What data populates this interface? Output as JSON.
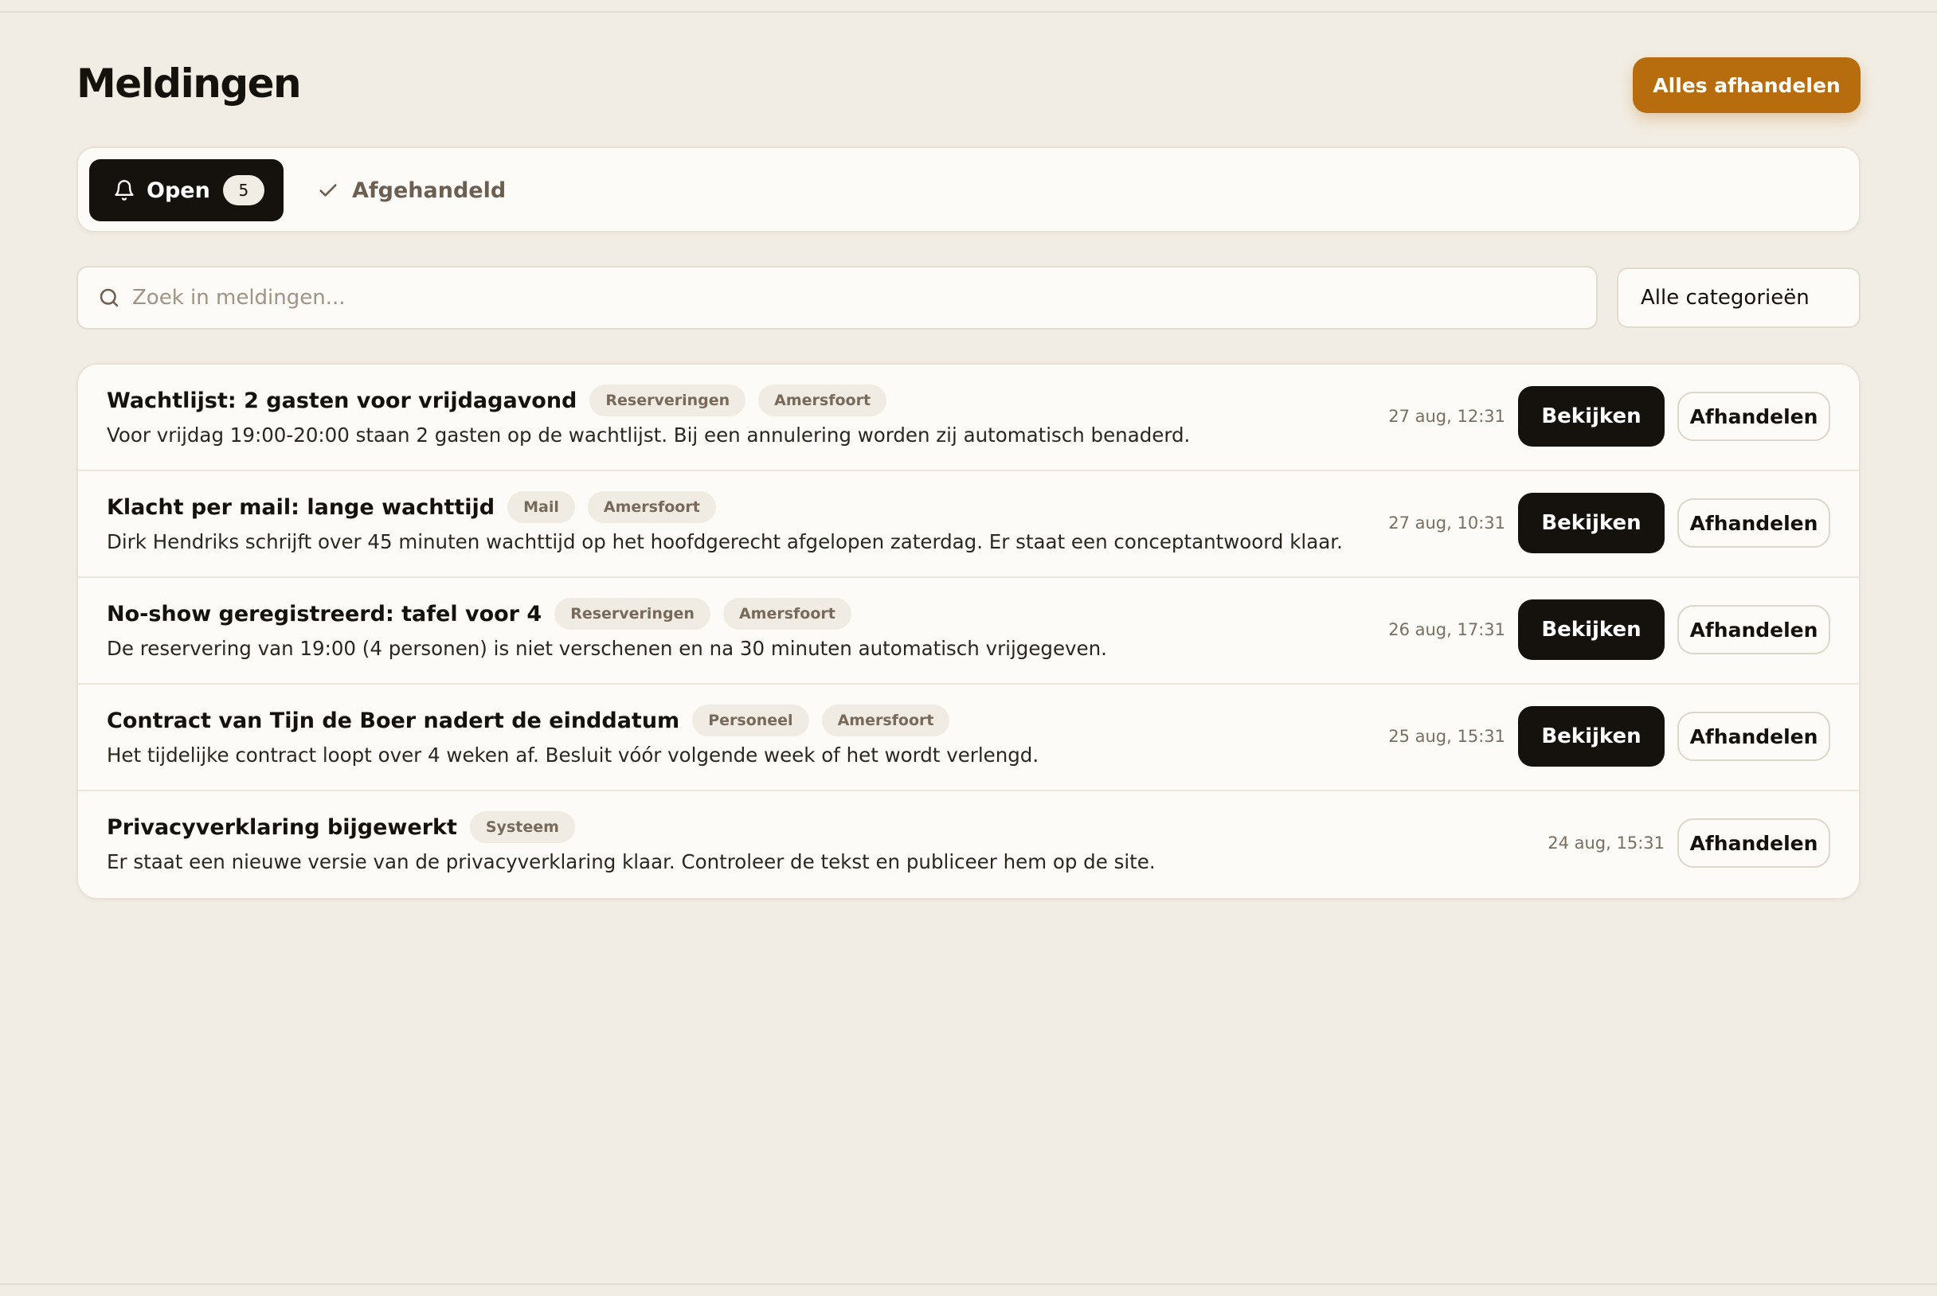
{
  "header": {
    "title": "Meldingen",
    "primary_action": "Alles afhandelen"
  },
  "tabs": {
    "open": {
      "label": "Open",
      "count": "5"
    },
    "done": {
      "label": "Afgehandeld"
    }
  },
  "search": {
    "placeholder": "Zoek in meldingen..."
  },
  "filter": {
    "selected": "Alle categorieën"
  },
  "actions": {
    "view": "Bekijken",
    "handle": "Afhandelen"
  },
  "notifications": [
    {
      "title": "Wachtlijst: 2 gasten voor vrijdagavond",
      "tags": [
        "Reserveringen",
        "Amersfoort"
      ],
      "description": "Voor vrijdag 19:00-20:00 staan 2 gasten op de wachtlijst. Bij een annulering worden zij automatisch benaderd.",
      "time": "27 aug, 12:31"
    },
    {
      "title": "Klacht per mail: lange wachttijd",
      "tags": [
        "Mail",
        "Amersfoort"
      ],
      "description": "Dirk Hendriks schrijft over 45 minuten wachttijd op het hoofdgerecht afgelopen zaterdag. Er staat een conceptantwoord klaar.",
      "time": "27 aug, 10:31"
    },
    {
      "title": "No-show geregistreerd: tafel voor 4",
      "tags": [
        "Reserveringen",
        "Amersfoort"
      ],
      "description": "De reservering van 19:00 (4 personen) is niet verschenen en na 30 minuten automatisch vrijgegeven.",
      "time": "26 aug, 17:31"
    },
    {
      "title": "Contract van Tijn de Boer nadert de einddatum",
      "tags": [
        "Personeel",
        "Amersfoort"
      ],
      "description": "Het tijdelijke contract loopt over 4 weken af. Besluit vóór volgende week of het wordt verlengd.",
      "time": "25 aug, 15:31"
    },
    {
      "title": "Privacyverklaring bijgewerkt",
      "tags": [
        "Systeem"
      ],
      "description": "Er staat een nieuwe versie van de privacyverklaring klaar. Controleer de tekst en publiceer hem op de site.",
      "time": "24 aug, 15:31"
    }
  ],
  "colors": {
    "background": "#f2ede4",
    "accent": "#b76d0d",
    "dark": "#15110d"
  }
}
